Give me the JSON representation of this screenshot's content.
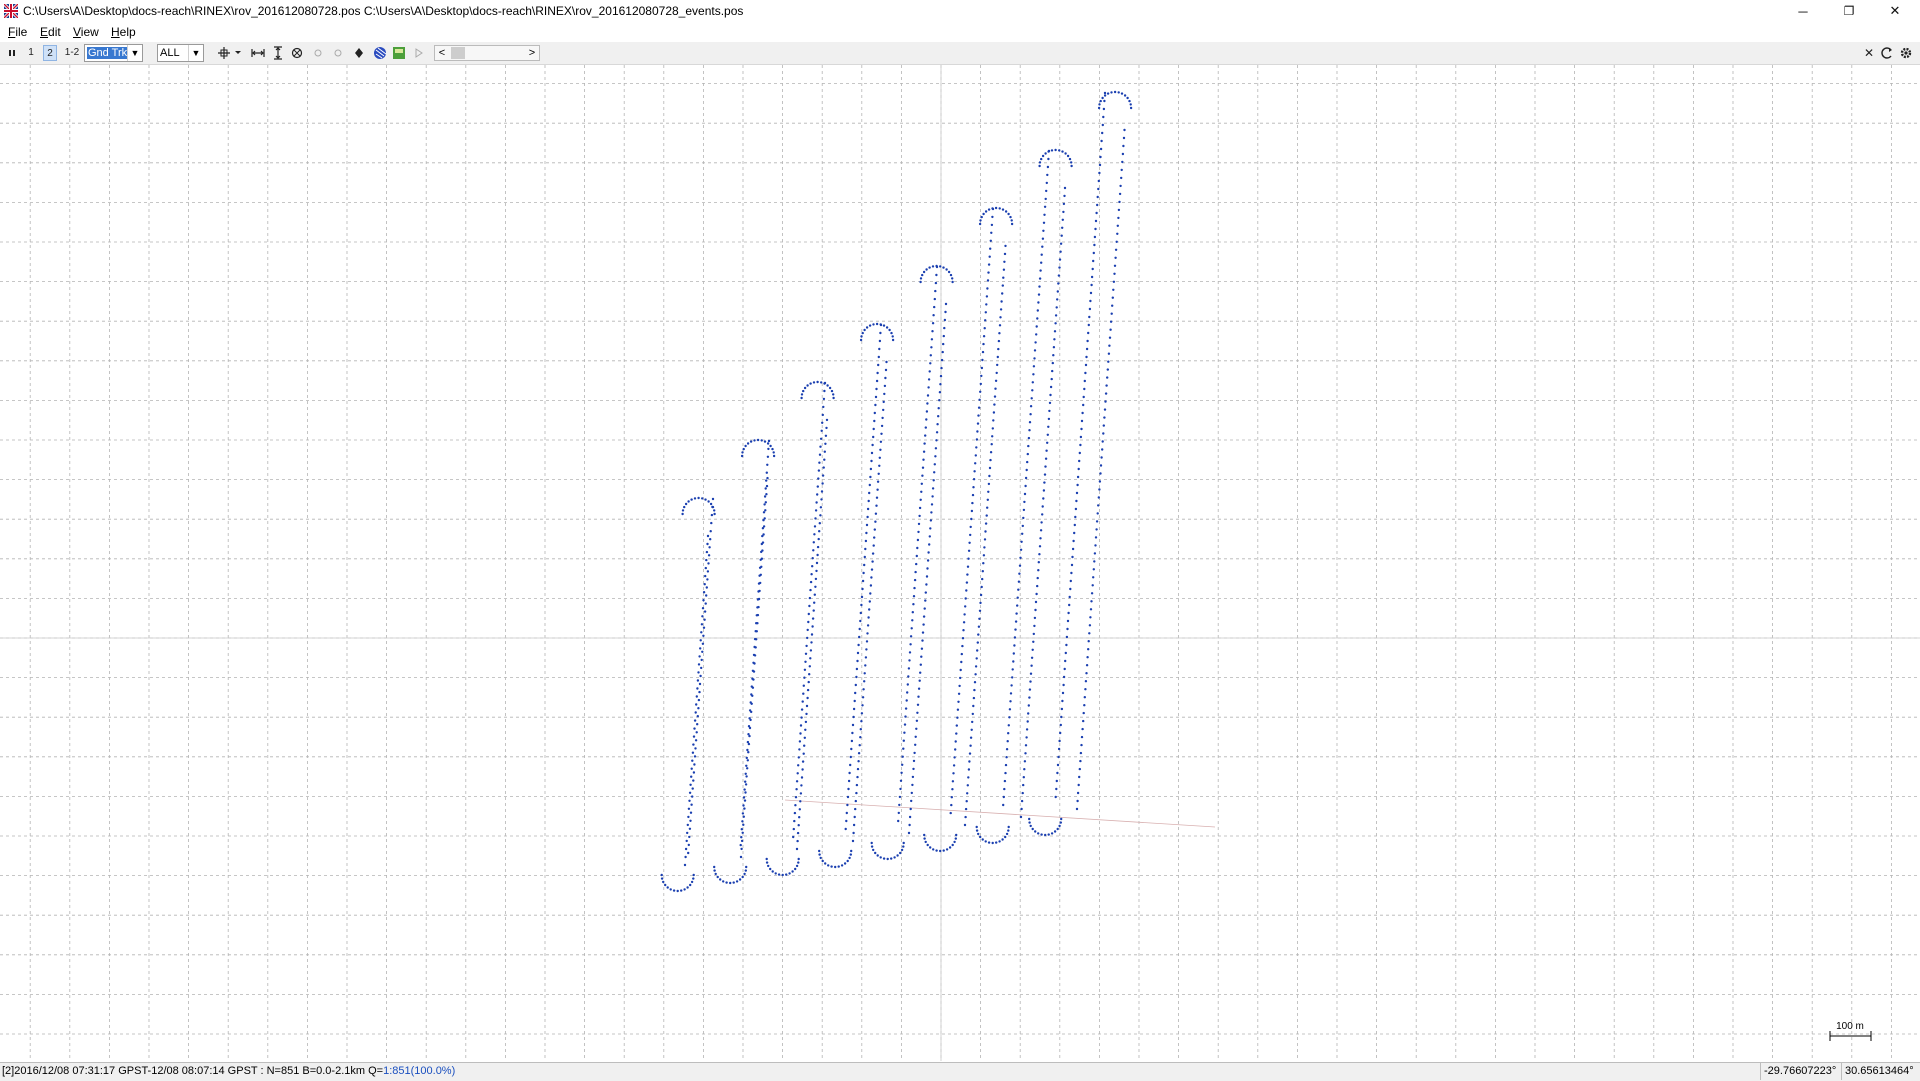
{
  "window": {
    "title": "C:\\Users\\A\\Desktop\\docs-reach\\RINEX\\rov_201612080728.pos C:\\Users\\A\\Desktop\\docs-reach\\RINEX\\rov_201612080728_events.pos",
    "minimize_glyph": "─",
    "restore_glyph": "❐",
    "close_glyph": "✕"
  },
  "menu": {
    "file": {
      "accel": "F",
      "rest": "ile"
    },
    "edit": {
      "accel": "E",
      "rest": "dit"
    },
    "view": {
      "accel": "V",
      "rest": "iew"
    },
    "help": {
      "accel": "H",
      "rest": "elp"
    }
  },
  "toolbar": {
    "btn_both_label": "1",
    "btn_2_label": "2",
    "btn_12_label": "1-2",
    "plot_type": "Gnd Trk",
    "quality_filter": "ALL",
    "scroll_left": "<",
    "scroll_right": ">",
    "close_glyph": "✕"
  },
  "plot": {
    "background": "#ffffff",
    "grid_color": "#b4b4b4",
    "axis_color": "#c8c8c8",
    "point_color": "#1a3fb0",
    "scale_label": "100 m"
  },
  "status": {
    "left_prefix": "[2]2016/12/08 07:31:17 GPST-12/08 08:07:14 GPST : N=851 B=0.0-2.1km Q=",
    "q_value": "1:851(100.0%)",
    "latitude": "-29.76607223°",
    "longitude": "30.65613464°"
  },
  "icons": [
    "app-icon",
    "pause-icon",
    "crosshair-icon",
    "fit-horizontal-icon",
    "fit-vertical-icon",
    "center-icon",
    "point-icon",
    "show-map-icon",
    "sky-icon",
    "image-icon",
    "play-icon",
    "reload-icon",
    "gear-icon"
  ]
}
